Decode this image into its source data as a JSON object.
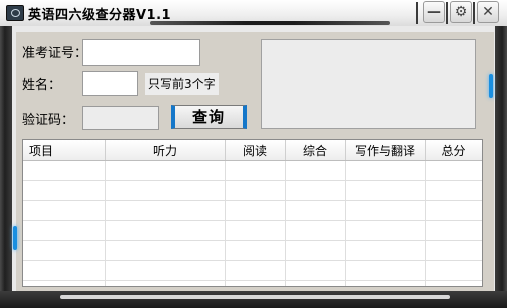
{
  "window": {
    "title": "英语四六级查分器V1.1",
    "controls": [
      {
        "name": "minimize-button",
        "glyph": "—"
      },
      {
        "name": "settings-button",
        "glyph": "⚙"
      },
      {
        "name": "close-button",
        "glyph": "✕"
      }
    ]
  },
  "form": {
    "ticket_label": "准考证号：",
    "ticket_value": "",
    "name_label": "姓名：",
    "name_value": "",
    "name_hint": "只写前3个字",
    "captcha_label": "验证码：",
    "captcha_value": "",
    "query_button": "查询"
  },
  "results": {
    "columns": [
      "项目",
      "听力",
      "阅读",
      "综合",
      "写作与翻译",
      "总分"
    ],
    "rows": [
      [
        "",
        "",
        "",
        "",
        "",
        ""
      ],
      [
        "",
        "",
        "",
        "",
        "",
        ""
      ],
      [
        "",
        "",
        "",
        "",
        "",
        ""
      ],
      [
        "",
        "",
        "",
        "",
        "",
        ""
      ],
      [
        "",
        "",
        "",
        "",
        "",
        ""
      ],
      [
        "",
        "",
        "",
        "",
        "",
        ""
      ],
      [
        "",
        "",
        "",
        "",
        "",
        ""
      ]
    ]
  },
  "colors": {
    "accent_blue": "#1577c9",
    "frame_dark": "#202020",
    "panel_bg": "#d4d0c8"
  }
}
